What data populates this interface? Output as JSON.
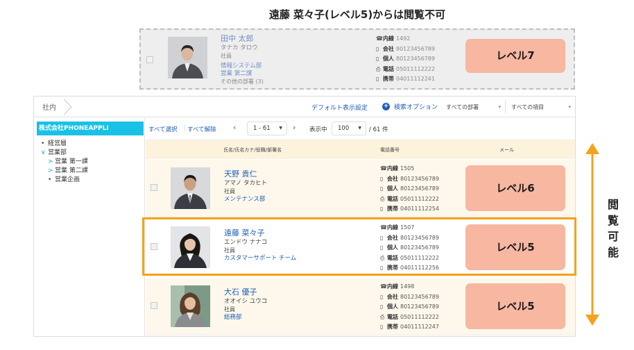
{
  "heading": "遠藤 菜々子(レベル5)からは閲覧不可",
  "restricted_card": {
    "name": "田中 太郎",
    "kana": "タナカ タロウ",
    "role": "社員",
    "dept_lines": [
      "情報システム部",
      "営業 第二課"
    ],
    "other_depts": "その他の部署 (3)",
    "phones": [
      {
        "icon": "phone-icon",
        "label": "内線",
        "number": "1492"
      },
      {
        "icon": "mobile-icon",
        "label": "会社",
        "number": "80123456789"
      },
      {
        "icon": "mobile-icon",
        "label": "個人",
        "number": "80123456789"
      },
      {
        "icon": "fax-icon",
        "label": "電話",
        "number": "05011112222"
      },
      {
        "icon": "mobile-icon",
        "label": "携帯",
        "number": "04011112241"
      }
    ],
    "level": "レベル7"
  },
  "topbar": {
    "breadcrumb": "社内",
    "default_view": "デフォルト表示設定",
    "search_options": "検索オプション",
    "dept_filter": "すべての部署",
    "item_filter": "すべての項目"
  },
  "sidebar": {
    "company": "株式会社PHONEAPPLI",
    "tree": [
      {
        "marker": "•",
        "label": "経営層",
        "indent": 0
      },
      {
        "marker": "∨",
        "label": "営業部",
        "indent": 0
      },
      {
        "marker": ">",
        "label": "営業 第一課",
        "indent": 1
      },
      {
        "marker": ">",
        "label": "営業 第二課",
        "indent": 1
      },
      {
        "marker": "•",
        "label": "営業企画",
        "indent": 1
      }
    ]
  },
  "toolbar": {
    "select_all": "すべて選択",
    "clear_all": "すべて解除",
    "page_range": "1 - 61",
    "show_label": "表示中",
    "per_page": "100",
    "total": "/ 61 件"
  },
  "columns": {
    "name": "氏名/氏名カナ/役職/部署名",
    "phone": "電話番号",
    "mail": "メール"
  },
  "rows": [
    {
      "name": "天野 貴仁",
      "kana": "アマノ タカヒト",
      "role": "社員",
      "dept": "メンテナンス部",
      "phones": [
        {
          "icon": "phone-icon",
          "label": "内線",
          "number": "1505"
        },
        {
          "icon": "mobile-icon",
          "label": "会社",
          "number": "80123456789"
        },
        {
          "icon": "mobile-icon",
          "label": "個人",
          "number": "80123456789"
        },
        {
          "icon": "fax-icon",
          "label": "電話",
          "number": "05011112222"
        },
        {
          "icon": "mobile-icon",
          "label": "携帯",
          "number": "04011112254"
        }
      ],
      "level": "レベル6"
    },
    {
      "name": "遠藤 菜々子",
      "kana": "エンドウ ナナコ",
      "role": "社員",
      "dept": "カスタマーサポート チーム",
      "phones": [
        {
          "icon": "phone-icon",
          "label": "内線",
          "number": "1507"
        },
        {
          "icon": "mobile-icon",
          "label": "会社",
          "number": "80123456789"
        },
        {
          "icon": "mobile-icon",
          "label": "個人",
          "number": "80123456789"
        },
        {
          "icon": "fax-icon",
          "label": "電話",
          "number": "05011112222"
        },
        {
          "icon": "mobile-icon",
          "label": "携帯",
          "number": "04011112256"
        }
      ],
      "level": "レベル5"
    },
    {
      "name": "大石 優子",
      "kana": "オオイシ ユウコ",
      "role": "社員",
      "dept": "総務部",
      "phones": [
        {
          "icon": "phone-icon",
          "label": "内線",
          "number": "1498"
        },
        {
          "icon": "mobile-icon",
          "label": "会社",
          "number": "80123456789"
        },
        {
          "icon": "mobile-icon",
          "label": "個人",
          "number": "80123456789"
        },
        {
          "icon": "fax-icon",
          "label": "電話",
          "number": "05011112222"
        },
        {
          "icon": "mobile-icon",
          "label": "携帯",
          "number": "04011112247"
        }
      ],
      "level": "レベル5"
    }
  ],
  "side_label": "閲覧可能",
  "colors": {
    "accent": "#f5a21a",
    "company_bar": "#19c1e6",
    "level_badge": "#f7b7a1",
    "link": "#1e5eb4"
  }
}
